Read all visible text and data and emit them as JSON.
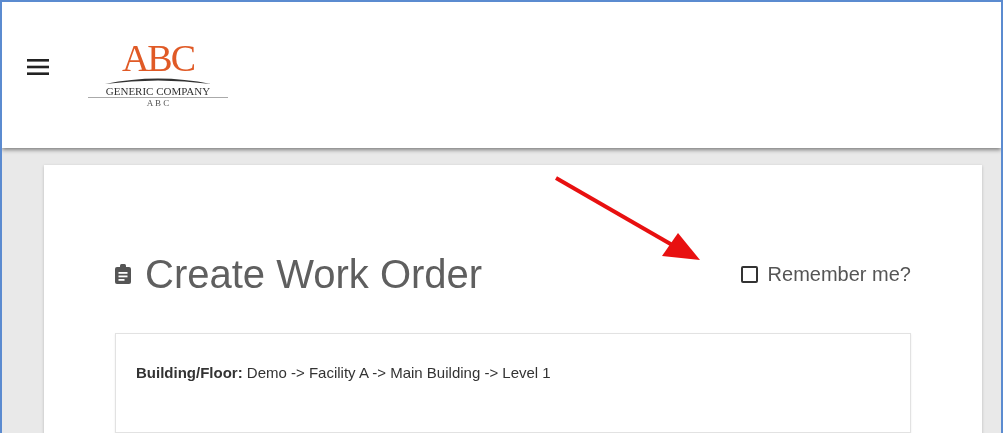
{
  "header": {
    "logo": {
      "title": "ABC",
      "name": "GENERIC COMPANY",
      "tagline": "A B C"
    }
  },
  "page": {
    "title": "Create Work Order",
    "remember": {
      "label": "Remember me?",
      "checked": false
    },
    "location": "**Building/Floor:** Demo -> Facility A -> Main Building -> Level 1"
  }
}
